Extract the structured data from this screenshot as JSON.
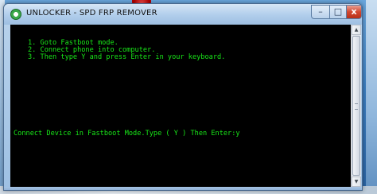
{
  "window": {
    "title": "UNLOCKER - SPD FRP REMOVER",
    "controls": {
      "minimize": "–",
      "maximize": "□",
      "close": "x"
    }
  },
  "console": {
    "lines": [
      "1. Goto Fastboot mode.",
      "2. Connect phone into computer.",
      "3. Then type Y and press Enter in your keyboard.",
      "Connect Device in Fastboot Mode.Type ( Y ) Then Enter:y"
    ],
    "text_color": "#18e818",
    "background": "#000000"
  },
  "scrollbar": {
    "up_arrow": "▲",
    "down_arrow": "▼"
  }
}
